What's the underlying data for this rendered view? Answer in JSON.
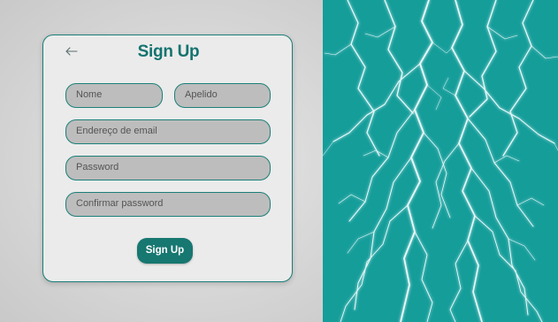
{
  "form": {
    "title": "Sign Up",
    "back_icon": "arrow-left-icon",
    "fields": {
      "first_name": {
        "placeholder": "Nome"
      },
      "last_name": {
        "placeholder": "Apelido"
      },
      "email": {
        "placeholder": "Endereço de email"
      },
      "password": {
        "placeholder": "Password"
      },
      "confirm_password": {
        "placeholder": "Confirmar password"
      }
    },
    "submit_label": "Sign Up"
  },
  "colors": {
    "accent": "#13736f",
    "button": "#177771",
    "field_fill": "#bdbdbd",
    "field_border": "#1b7f79",
    "right_panel": "#159d9a"
  },
  "decor": {
    "right_panel_image": "lightning-image"
  }
}
